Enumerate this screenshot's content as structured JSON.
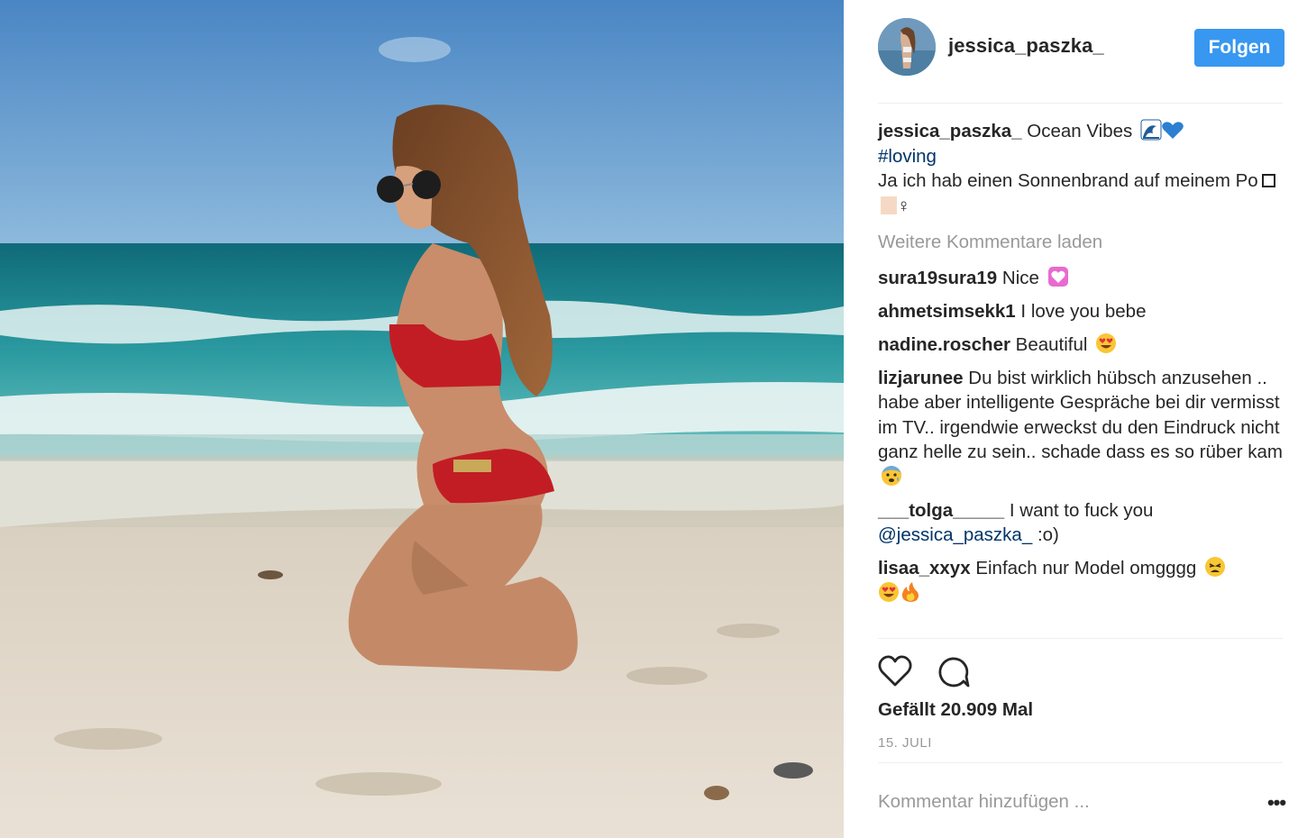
{
  "post": {
    "username": "jessica_paszka_",
    "follow_label": "Folgen",
    "caption": {
      "username": "jessica_paszka_",
      "text_line1": "Ocean Vibes",
      "hashtag": "#loving",
      "text_line2": "Ja ich hab einen Sonnenbrand auf meinem Po",
      "emoji_symbol": "♀"
    },
    "load_more_label": "Weitere Kommentare laden",
    "comments": [
      {
        "username": "sura19sura19",
        "text": "Nice"
      },
      {
        "username": "ahmetsimsekk1",
        "text": "I love you bebe"
      },
      {
        "username": "nadine.roscher",
        "text": "Beautiful"
      },
      {
        "username": "lizjarunee",
        "text": "Du bist wirklich hübsch anzusehen .. habe aber intelligente Gespräche bei dir vermisst im TV.. irgendwie erweckst du den Eindruck nicht ganz helle zu sein.. schade dass es so rüber kam"
      },
      {
        "username": "___tolga_____",
        "text": "I want to fuck you",
        "mention": "@jessica_paszka_",
        "text_after": ":o)"
      },
      {
        "username": "lisaa_xxyx",
        "text": "Einfach nur Model omgggg"
      }
    ],
    "likes_label": "Gefällt 20.909 Mal",
    "date_label": "15. JULI",
    "comment_placeholder": "Kommentar hinzufügen ...",
    "more_label": "•••",
    "colors": {
      "accent": "#3897f0",
      "link": "#003569",
      "muted": "#999999",
      "text": "#262626"
    },
    "icons": [
      "like-heart-icon",
      "comment-bubble-icon",
      "more-options-icon"
    ]
  }
}
